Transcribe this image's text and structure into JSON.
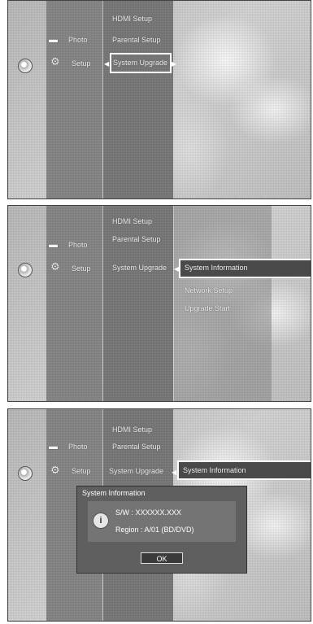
{
  "screen1": {
    "menu": {
      "photo_label": "Photo",
      "setup_label": "Setup"
    },
    "submenu": [
      "HDMI Setup",
      "Parental Setup",
      "System Upgrade"
    ],
    "selected": "System Upgrade"
  },
  "screen2": {
    "menu": {
      "photo_label": "Photo",
      "setup_label": "Setup"
    },
    "submenu": [
      "HDMI Setup",
      "Parental Setup",
      "System Upgrade"
    ],
    "options": [
      "System Information",
      "Network Setup",
      "Upgrade Start"
    ],
    "selected": "System Information"
  },
  "screen3": {
    "menu": {
      "photo_label": "Photo",
      "setup_label": "Setup"
    },
    "submenu": [
      "HDMI Setup",
      "Parental Setup",
      "System Upgrade"
    ],
    "selected_option": "System Information",
    "dialog": {
      "title": "System Information",
      "sw_line": "S/W : XXXXXX.XXX",
      "region_line": "Region : A/01 (BD/DVD)",
      "ok_label": "OK"
    }
  }
}
